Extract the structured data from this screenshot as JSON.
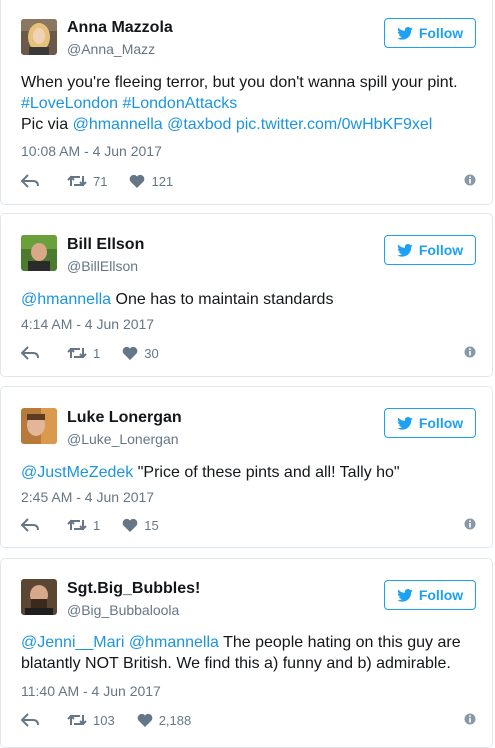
{
  "colors": {
    "accent": "#1da1f2",
    "link": "#1b95e0",
    "muted": "#657786",
    "text": "#14171a"
  },
  "tweets": [
    {
      "name": "Anna Mazzola",
      "handle": "@Anna_Mazz",
      "follow_label": "Follow",
      "text_plain_1": "When you're fleeing terror, but you don't wanna spill your pint.",
      "hashtag_1": "#LoveLondon",
      "hashtag_2": "#LondonAttacks",
      "pic_via": "Pic via",
      "mention_1": "@hmannella",
      "mention_2": "@taxbod",
      "pic_link": "pic.twitter.com/0wHbKF9xel",
      "time": "10:08 AM - 4 Jun 2017",
      "retweets": "71",
      "likes": "121"
    },
    {
      "name": "Bill Ellson",
      "handle": "@BillEllson",
      "follow_label": "Follow",
      "mention_1": "@hmannella",
      "text_plain_1": "One has to maintain standards",
      "time": "4:14 AM - 4 Jun 2017",
      "retweets": "1",
      "likes": "30"
    },
    {
      "name": "Luke Lonergan",
      "handle": "@Luke_Lonergan",
      "follow_label": "Follow",
      "mention_1": "@JustMeZedek",
      "text_plain_1": "\"Price of these pints and all! Tally ho\"",
      "time": "2:45 AM - 4 Jun 2017",
      "retweets": "1",
      "likes": "15"
    },
    {
      "name": "Sgt.Big_Bubbles!",
      "handle": "@Big_Bubbaloola",
      "follow_label": "Follow",
      "mention_1": "@Jenni__Mari",
      "mention_2": "@hmannella",
      "text_plain_1": "The people hating on this guy are blatantly NOT British. We find this a) funny and b) admirable.",
      "time": "11:40 AM - 4 Jun 2017",
      "retweets": "103",
      "likes": "2,188"
    }
  ],
  "icons": {
    "follow": "twitter-bird-icon",
    "reply": "reply-icon",
    "retweet": "retweet-icon",
    "like": "heart-icon",
    "info": "info-icon"
  }
}
